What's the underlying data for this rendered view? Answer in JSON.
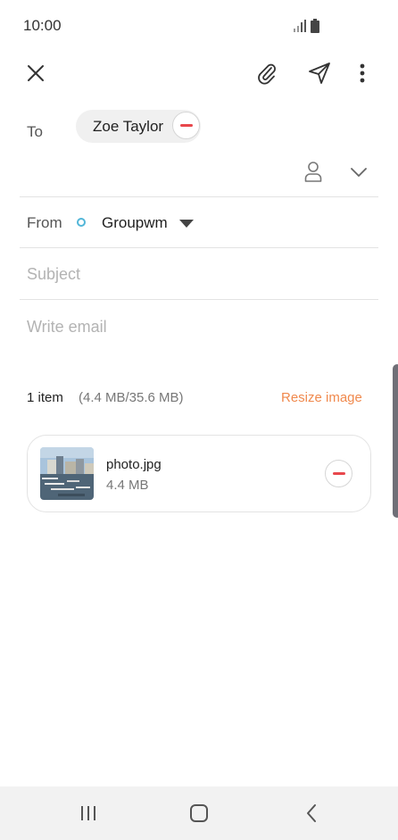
{
  "status_bar": {
    "time": "10:00",
    "signal_icon": "signal-icon",
    "battery_icon": "battery-icon"
  },
  "toolbar": {
    "close_icon": "close-icon",
    "attach_icon": "paperclip-icon",
    "send_icon": "send-icon",
    "more_icon": "more-vertical-icon"
  },
  "compose": {
    "to_label": "To",
    "recipients": [
      {
        "name": "Zoe Taylor"
      }
    ],
    "from_label": "From",
    "from_account": "Groupwm",
    "subject_placeholder": "Subject",
    "body_placeholder": "Write email"
  },
  "attachments": {
    "count_label": "1 item",
    "size_label": "(4.4 MB/35.6 MB)",
    "resize_label": "Resize image",
    "items": [
      {
        "file_name": "photo.jpg",
        "file_size": "4.4 MB"
      }
    ]
  },
  "colors": {
    "accent": "#f0894d",
    "remove": "#e8474c",
    "account_dot": "#52b6d8"
  },
  "nav": {
    "recent_icon": "recent-apps-icon",
    "home_icon": "home-icon",
    "back_icon": "back-icon"
  }
}
